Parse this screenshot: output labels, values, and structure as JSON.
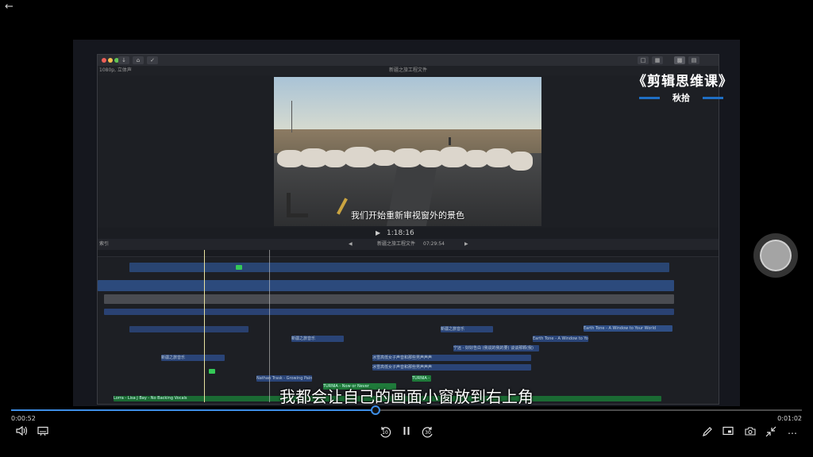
{
  "player": {
    "current_time": "0:00:52",
    "total_time": "0:01:02",
    "progress": 0.46,
    "subtitle": "我都会让自己的画面小窗放到右上角",
    "icons": {
      "back": "back-arrow-icon",
      "volume": "volume-icon",
      "captions": "captions-icon",
      "rewind": "rewind-10-icon",
      "pause": "pause-icon",
      "forward": "forward-30-icon",
      "draw": "pen-icon",
      "cast": "cast-icon",
      "screenshot": "camera-icon",
      "exit_fullscreen": "exit-fullscreen-icon",
      "more": "more-icon"
    },
    "rewind_seconds": "10",
    "forward_seconds": "30"
  },
  "branding": {
    "title": "《剪辑思维课》",
    "author": "秋拾",
    "accent": "#1f6fc4"
  },
  "editor": {
    "window_title": "新疆之旅工程文件",
    "format_label": "1080p, 立体声",
    "viewer_subtitle": "我们开始重新审视窗外的景色",
    "timecode": "1:18:16",
    "timeline_project": "新疆之旅工程文件",
    "timeline_duration": "07:29:54",
    "index_label": "索引",
    "clip_labels": {
      "music_1": "Nathan Trask - Growing Pains",
      "music_2": "TURNIA - Now or Never",
      "music_3": "TURNIA - ...",
      "bottom_track": "Lorra - Lisa J Bay - No Backing Vocals",
      "audio_1": "Earth Tone - A Window to Your World",
      "audio_2": "Earth Tone - A Window to Your World",
      "caption_1": "宁远 - 好好告白 (我说的我的要) 谈谈那颗(我)",
      "caption_2": "冰雪高低女子声音和那些男声声声",
      "caption_3": "冰雪高低女子声音和那些男声声声",
      "caption_4": "新疆之旅音乐",
      "caption_5": "新疆之旅音乐",
      "caption_6": "新疆之旅音乐"
    }
  }
}
